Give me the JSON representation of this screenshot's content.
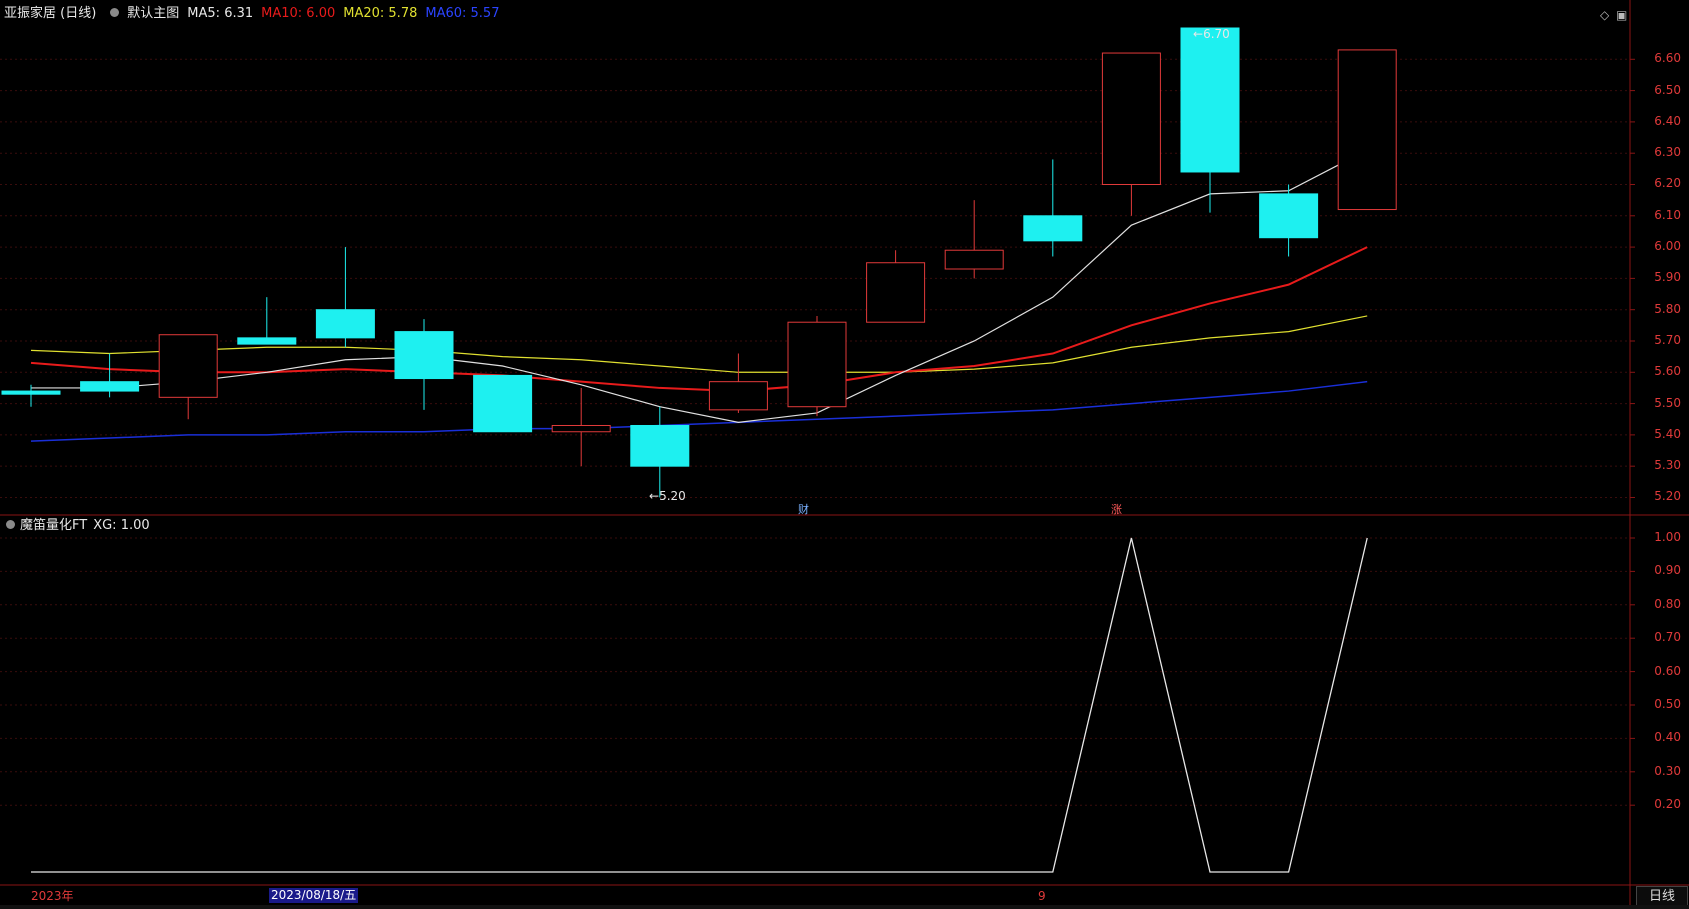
{
  "header": {
    "stock": "亚振家居 (日线)",
    "template": "默认主图",
    "ma5_label": "MA5: 6.31",
    "ma10_label": "MA10: 6.00",
    "ma20_label": "MA20: 5.78",
    "ma60_label": "MA60: 5.57"
  },
  "indicator": {
    "name": "魔笛量化FT",
    "xg_label": "XG: 1.00"
  },
  "price_axis": [
    "6.60",
    "6.50",
    "6.40",
    "6.30",
    "6.20",
    "6.10",
    "6.00",
    "5.90",
    "5.80",
    "5.70",
    "5.60",
    "5.50",
    "5.40",
    "5.30",
    "5.20"
  ],
  "indicator_axis": [
    "1.00",
    "0.90",
    "0.80",
    "0.70",
    "0.60",
    "0.50",
    "0.40",
    "0.30",
    "0.20"
  ],
  "annotations": {
    "high_label": "6.70",
    "low_label": "5.20",
    "marker_cai": "财",
    "marker_zhang": "涨"
  },
  "time_axis": {
    "year": "2023年",
    "cursor_date": "2023/08/18/五",
    "month": "9"
  },
  "period_button": "日线",
  "colors": {
    "up": "#e23a3a",
    "down": "#1ef0f0",
    "ma5": "#e0e0e0",
    "ma10": "#e81b1b",
    "ma20": "#e0e030",
    "ma60": "#1a2fd8",
    "indicator_line": "#e8e8e8",
    "axis": "#8a1515"
  },
  "chart_data": {
    "type": "candlestick",
    "candles": [
      {
        "open": 5.54,
        "close": 5.53,
        "high": 5.56,
        "low": 5.49
      },
      {
        "open": 5.57,
        "close": 5.54,
        "high": 5.66,
        "low": 5.52
      },
      {
        "open": 5.52,
        "close": 5.72,
        "high": 5.72,
        "low": 5.45
      },
      {
        "open": 5.71,
        "close": 5.69,
        "high": 5.84,
        "low": 5.69
      },
      {
        "open": 5.8,
        "close": 5.71,
        "high": 6.0,
        "low": 5.68
      },
      {
        "open": 5.73,
        "close": 5.58,
        "high": 5.77,
        "low": 5.48
      },
      {
        "open": 5.59,
        "close": 5.41,
        "high": 5.59,
        "low": 5.41
      },
      {
        "open": 5.41,
        "close": 5.43,
        "high": 5.55,
        "low": 5.3
      },
      {
        "open": 5.43,
        "close": 5.3,
        "high": 5.49,
        "low": 5.2
      },
      {
        "open": 5.48,
        "close": 5.57,
        "high": 5.66,
        "low": 5.47
      },
      {
        "open": 5.49,
        "close": 5.76,
        "high": 5.78,
        "low": 5.46
      },
      {
        "open": 5.76,
        "close": 5.95,
        "high": 5.99,
        "low": 5.76
      },
      {
        "open": 5.93,
        "close": 5.99,
        "high": 6.15,
        "low": 5.9
      },
      {
        "open": 6.1,
        "close": 6.02,
        "high": 6.28,
        "low": 5.97
      },
      {
        "open": 6.2,
        "close": 6.62,
        "high": 6.62,
        "low": 6.1
      },
      {
        "open": 6.7,
        "close": 6.24,
        "high": 6.7,
        "low": 6.11
      },
      {
        "open": 6.17,
        "close": 6.03,
        "high": 6.2,
        "low": 5.97
      },
      {
        "open": 6.12,
        "close": 6.63,
        "high": 6.63,
        "low": 6.12
      }
    ],
    "ma5": [
      5.55,
      5.55,
      5.57,
      5.6,
      5.64,
      5.65,
      5.62,
      5.56,
      5.49,
      5.44,
      5.47,
      5.59,
      5.7,
      5.84,
      6.07,
      6.17,
      6.18,
      6.31
    ],
    "ma10": [
      5.63,
      5.61,
      5.6,
      5.6,
      5.61,
      5.6,
      5.59,
      5.57,
      5.55,
      5.54,
      5.56,
      5.6,
      5.62,
      5.66,
      5.75,
      5.82,
      5.88,
      6.0
    ],
    "ma20": [
      5.67,
      5.66,
      5.67,
      5.68,
      5.68,
      5.67,
      5.65,
      5.64,
      5.62,
      5.6,
      5.6,
      5.6,
      5.61,
      5.63,
      5.68,
      5.71,
      5.73,
      5.78
    ],
    "ma60": [
      5.38,
      5.39,
      5.4,
      5.4,
      5.41,
      5.41,
      5.42,
      5.42,
      5.43,
      5.44,
      5.45,
      5.46,
      5.47,
      5.48,
      5.5,
      5.52,
      5.54,
      5.57
    ],
    "xg": [
      0,
      0,
      0,
      0,
      0,
      0,
      0,
      0,
      0,
      0,
      0,
      0,
      0,
      0,
      1,
      0,
      0,
      1
    ],
    "price_range": [
      5.16,
      6.7
    ],
    "indicator_range": [
      0,
      1.0
    ]
  }
}
